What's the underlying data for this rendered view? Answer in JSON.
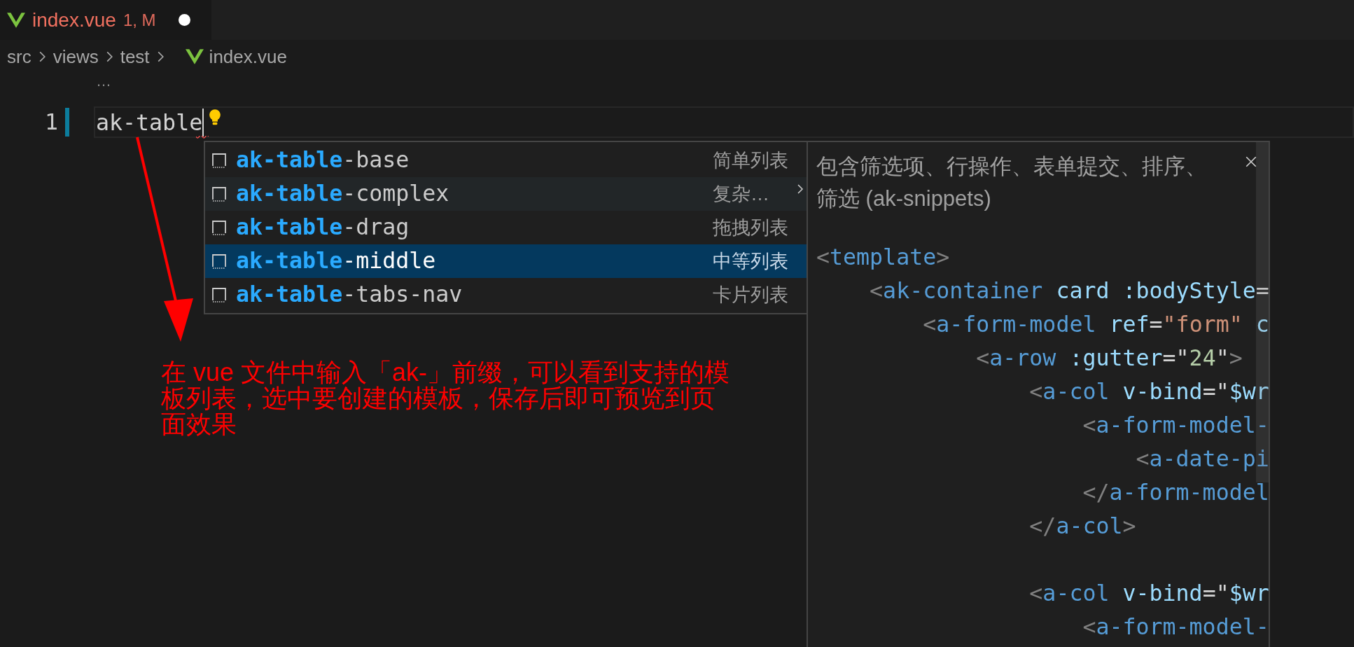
{
  "tab": {
    "title": "index.vue",
    "badge": "1, M",
    "dirty": true
  },
  "breadcrumb": [
    "src",
    "views",
    "test",
    "index.vue"
  ],
  "folded_marker": "…",
  "editor": {
    "line_number": "1",
    "text": "ak-table",
    "error": true
  },
  "suggestions": [
    {
      "label": "**ak-table**-base",
      "detail": "简单列表",
      "selected": false,
      "hovered": false
    },
    {
      "label": "**ak-table**-complex",
      "detail": "复杂…",
      "selected": false,
      "hovered": true
    },
    {
      "label": "**ak-table**-drag",
      "detail": "拖拽列表",
      "selected": false,
      "hovered": false
    },
    {
      "label": "**ak-table**-middle",
      "detail": "中等列表",
      "selected": true,
      "hovered": false
    },
    {
      "label": "**ak-table**-tabs-nav",
      "detail": "卡片列表",
      "selected": false,
      "hovered": false
    }
  ],
  "details": {
    "description": "包含筛选项、行操作、表单提交、排序、筛选 (ak-snippets)",
    "code": [
      {
        "kind": "code",
        "tokens": [
          {
            "kind": "punct",
            "text": "<"
          },
          {
            "kind": "tag",
            "text": "template"
          },
          {
            "kind": "punct",
            "text": ">"
          }
        ]
      },
      {
        "kind": "code",
        "tokens": [
          {
            "kind": "punct",
            "text": "    <"
          },
          {
            "kind": "tag",
            "text": "ak-container"
          },
          {
            "kind": "attr",
            "text": " card :bodyStyle"
          },
          {
            "kind": "op",
            "text": "="
          }
        ]
      },
      {
        "kind": "code",
        "tokens": [
          {
            "kind": "punct",
            "text": "        <"
          },
          {
            "kind": "tag",
            "text": "a-form-model"
          },
          {
            "kind": "attr",
            "text": " ref"
          },
          {
            "kind": "op",
            "text": "="
          },
          {
            "kind": "string",
            "text": "\"form\""
          },
          {
            "kind": "attr",
            "text": " c"
          }
        ]
      },
      {
        "kind": "code",
        "tokens": [
          {
            "kind": "punct",
            "text": "            <"
          },
          {
            "kind": "tag",
            "text": "a-row"
          },
          {
            "kind": "attr",
            "text": " :gutter"
          },
          {
            "kind": "op",
            "text": "=\""
          },
          {
            "kind": "number",
            "text": "24"
          },
          {
            "kind": "op",
            "text": "\""
          },
          {
            "kind": "punct",
            "text": ">"
          }
        ]
      },
      {
        "kind": "code",
        "tokens": [
          {
            "kind": "punct",
            "text": "                <"
          },
          {
            "kind": "tag",
            "text": "a-col"
          },
          {
            "kind": "attr",
            "text": " v-bind"
          },
          {
            "kind": "op",
            "text": "=\""
          },
          {
            "kind": "attr",
            "text": "$wr"
          }
        ]
      },
      {
        "kind": "code",
        "tokens": [
          {
            "kind": "punct",
            "text": "                    <"
          },
          {
            "kind": "tag",
            "text": "a-form-model-"
          }
        ]
      },
      {
        "kind": "code",
        "tokens": [
          {
            "kind": "punct",
            "text": "                        <"
          },
          {
            "kind": "tag",
            "text": "a-date-pi"
          }
        ]
      },
      {
        "kind": "code",
        "tokens": [
          {
            "kind": "punct",
            "text": "                    </"
          },
          {
            "kind": "tag",
            "text": "a-form-model"
          }
        ]
      },
      {
        "kind": "code",
        "tokens": [
          {
            "kind": "punct",
            "text": "                </"
          },
          {
            "kind": "tag",
            "text": "a-col"
          },
          {
            "kind": "punct",
            "text": ">"
          }
        ]
      },
      {
        "kind": "blank"
      },
      {
        "kind": "code",
        "tokens": [
          {
            "kind": "punct",
            "text": "                <"
          },
          {
            "kind": "tag",
            "text": "a-col"
          },
          {
            "kind": "attr",
            "text": " v-bind"
          },
          {
            "kind": "op",
            "text": "=\""
          },
          {
            "kind": "attr",
            "text": "$wr"
          }
        ]
      },
      {
        "kind": "code",
        "tokens": [
          {
            "kind": "punct",
            "text": "                    <"
          },
          {
            "kind": "tag",
            "text": "a-form-model-"
          }
        ]
      }
    ]
  },
  "annotation": "在 vue 文件中输入「ak-」前缀，可以看到支持的模板列表，选中要创建的模板，保存后即可预览到页面效果"
}
